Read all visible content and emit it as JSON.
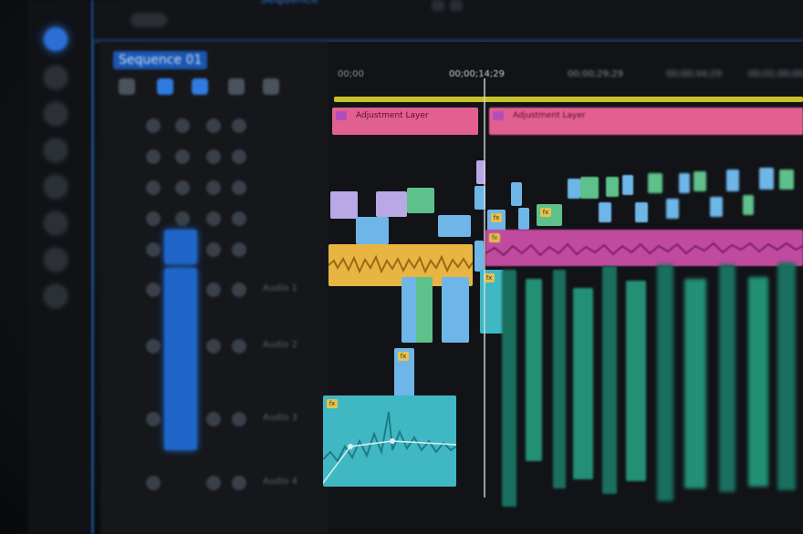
{
  "window": {
    "sequence_tab": "Sequence"
  },
  "timeline": {
    "timecodes": [
      {
        "label": "00;00",
        "current": false
      },
      {
        "label": "00;00;14;29",
        "current": true
      },
      {
        "label": "00;00;29;29",
        "current": false
      },
      {
        "label": "00;00;44;29",
        "current": false
      },
      {
        "label": "00;01;00;00",
        "current": false
      }
    ],
    "adjustment_clips": [
      {
        "label": "Adjustment Layer"
      },
      {
        "label": "Adjustment Layer"
      }
    ],
    "fx_badge": "fx"
  },
  "track_headers": {
    "sequence_name": "Sequence 01",
    "audio_labels": [
      "Audio 1",
      "Audio 2",
      "Audio 3",
      "Audio 4"
    ]
  },
  "colors": {
    "accent": "#2f7be0",
    "adjustment_clip": "#e2608f",
    "audio_clip_gold": "#e8b543",
    "audio_clip_magenta": "#c04a9e",
    "video_clip_lavender": "#b9a8e6",
    "video_clip_blue": "#6fb6e8",
    "video_clip_green": "#5ec08a",
    "audio_clip_teal": "#3fb8c4",
    "work_area_bar": "#c8c22a"
  }
}
